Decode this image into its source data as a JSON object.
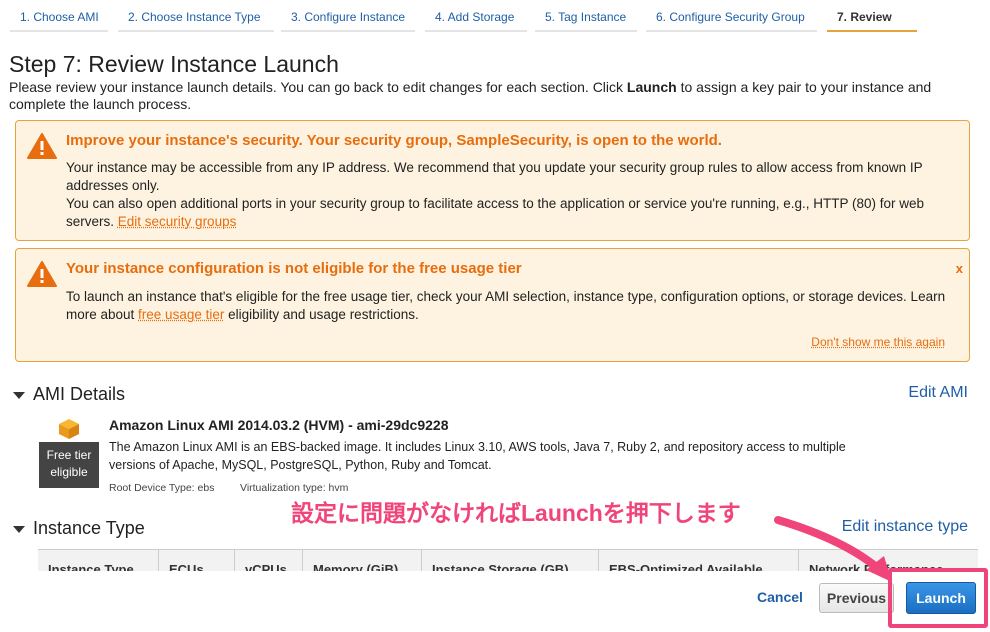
{
  "wizard": {
    "steps": [
      {
        "label": "1. Choose AMI"
      },
      {
        "label": "2. Choose Instance Type"
      },
      {
        "label": "3. Configure Instance"
      },
      {
        "label": "4. Add Storage"
      },
      {
        "label": "5. Tag Instance"
      },
      {
        "label": "6. Configure Security Group"
      },
      {
        "label": "7. Review"
      }
    ]
  },
  "page": {
    "title": "Step 7: Review Instance Launch",
    "desc_before": "Please review your instance launch details. You can go back to edit changes for each section. Click ",
    "desc_bold": "Launch",
    "desc_after": " to assign a key pair to your instance and complete the launch process."
  },
  "security_warning": {
    "title": "Improve your instance's security. Your security group, SampleSecurity, is open to the world.",
    "line1": "Your instance may be accessible from any IP address. We recommend that you update your security group rules to allow access from known IP addresses only.",
    "line2": "You can also open additional ports in your security group to facilitate access to the application or service you're running, e.g., HTTP (80) for web servers.",
    "link": "Edit security groups"
  },
  "free_tier_warning": {
    "title": "Your instance configuration is not eligible for the free usage tier",
    "close": "x",
    "body_before": "To launch an instance that's eligible for the free usage tier, check your AMI selection, instance type, configuration options, or storage devices. Learn more about ",
    "link": "free usage tier",
    "body_after": " eligibility and usage restrictions.",
    "dismiss": "Don't show me this again"
  },
  "ami": {
    "section_title": "AMI Details",
    "edit_link": "Edit AMI",
    "badge_line1": "Free tier",
    "badge_line2": "eligible",
    "name": "Amazon Linux AMI 2014.03.2 (HVM) - ami-29dc9228",
    "description": "The Amazon Linux AMI is an EBS-backed image. It includes Linux 3.10, AWS tools, Java 7, Ruby 2, and repository access to multiple versions of Apache, MySQL, PostgreSQL, Python, Ruby and Tomcat.",
    "root_device": "Root Device Type: ebs",
    "virtualization": "Virtualization type: hvm"
  },
  "instance_type": {
    "section_title": "Instance Type",
    "edit_link": "Edit instance type",
    "columns": [
      "Instance Type",
      "ECUs",
      "vCPUs",
      "Memory (GiB)",
      "Instance Storage (GB)",
      "EBS-Optimized Available",
      "Network Performance"
    ]
  },
  "annotation": {
    "text": "設定に問題がなければLaunchを押下します",
    "color": "#f0457a"
  },
  "footer": {
    "cancel": "Cancel",
    "previous": "Previous",
    "launch": "Launch"
  },
  "colors": {
    "accent_orange": "#e76d0f",
    "link_blue": "#1f5fa6",
    "launch_blue": "#1a7bd1",
    "highlight_pink": "#f0457a"
  }
}
